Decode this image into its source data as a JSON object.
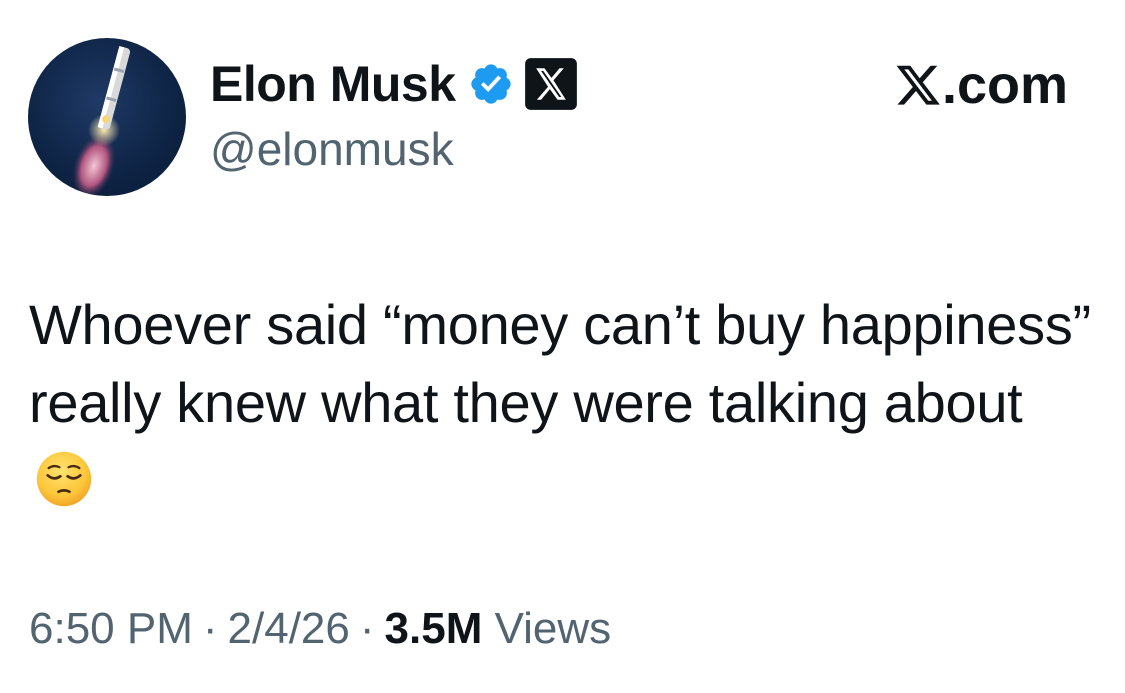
{
  "author": {
    "display_name": "Elon Musk",
    "handle": "@elonmusk",
    "verified_badge": "verified-check-icon",
    "affiliate_badge": "x-logo-icon",
    "avatar": "rocket-launch-avatar"
  },
  "brand": {
    "suffix": ".com",
    "icon": "x-logo-icon"
  },
  "tweet": {
    "text": "Whoever said “money can’t buy happiness” really knew what they were talking about",
    "emoji": "pensive-face-emoji"
  },
  "meta": {
    "time": "6:50 PM",
    "date": "2/4/26",
    "separator": "·",
    "views_count": "3.5M",
    "views_label": "Views"
  },
  "colors": {
    "text_primary": "#0f1419",
    "text_secondary": "#536471",
    "verified_blue": "#1d9bf0"
  }
}
